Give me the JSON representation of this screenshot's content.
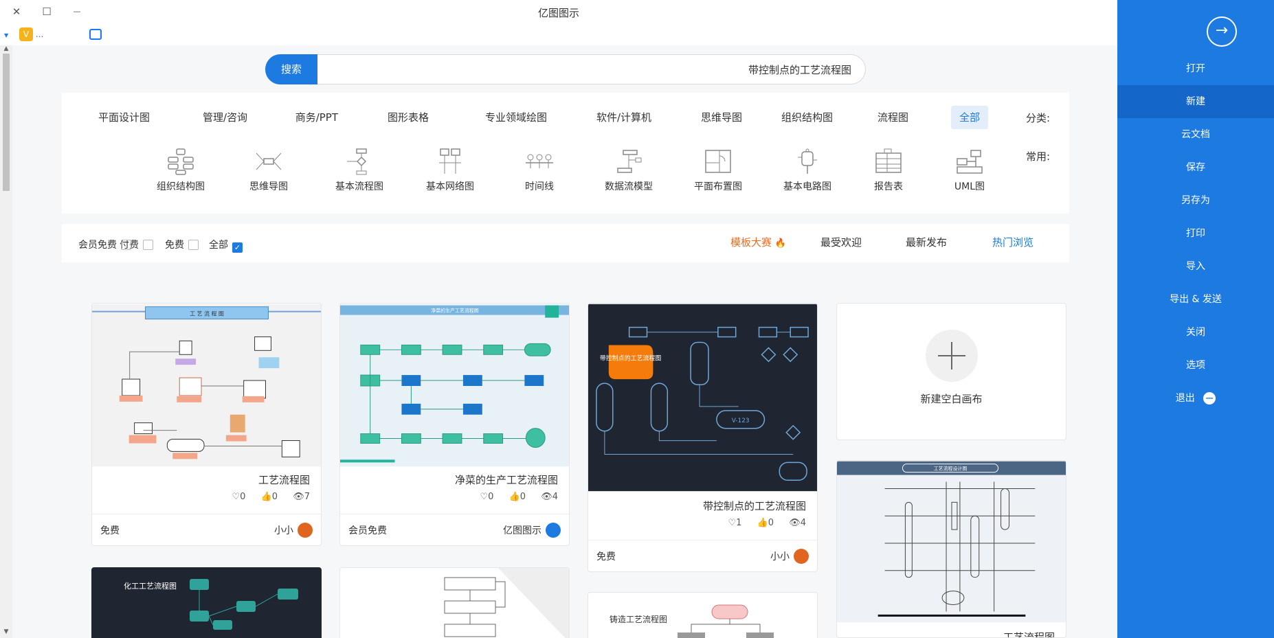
{
  "window": {
    "title": "亿图图示",
    "close": "✕",
    "maximize": "☐",
    "minimize": "—"
  },
  "toolbar": {
    "vip_dots": "...",
    "vip_symbol": "V"
  },
  "sidebar": {
    "back_icon": "→",
    "items": [
      "打开",
      "新建",
      "云文档",
      "保存",
      "另存为",
      "打印",
      "导入",
      "导出 & 发送",
      "关闭",
      "选项",
      "退出"
    ],
    "active": "新建",
    "exit_icon": "−"
  },
  "search": {
    "button": "搜索",
    "value": "带控制点的工艺流程图"
  },
  "categories": {
    "label": "分类:",
    "items": [
      "全部",
      "流程图",
      "组织结构图",
      "思维导图",
      "软件/计算机",
      "专业领域绘图",
      "图形表格",
      "商务/PPT",
      "管理/咨询",
      "平面设计图"
    ],
    "active": "全部"
  },
  "common": {
    "label": "常用:",
    "items": [
      "UML图",
      "报告表",
      "基本电路图",
      "平面布置图",
      "数据流模型",
      "时间线",
      "基本网络图",
      "基本流程图",
      "思维导图",
      "组织结构图"
    ]
  },
  "filters": {
    "tabs": [
      "热门浏览",
      "最新发布",
      "最受欢迎",
      "模板大赛"
    ],
    "active_tab": "热门浏览",
    "hot_icon": "🔥",
    "checks": [
      "全部",
      "免费",
      "付费",
      "会员免费"
    ],
    "checked": "全部",
    "check_mark": "✓"
  },
  "cards": [
    {
      "title": "工艺流程图",
      "views": "7",
      "likes": "0",
      "favs": "0",
      "author": "小小",
      "price": "免费"
    },
    {
      "title": "净菜的生产工艺流程图",
      "views": "4",
      "likes": "0",
      "favs": "0",
      "author": "亿图图示",
      "price": "会员免费"
    },
    {
      "title": "带控制点的工艺流程图",
      "views": "4",
      "likes": "0",
      "favs": "1",
      "author": "小小",
      "price": "免费"
    }
  ],
  "new_canvas": {
    "label": "新建空白画布"
  },
  "bottom_cards": {
    "c1_title": "化工工艺流程图",
    "c3_title": "铸造工艺流程图",
    "c4_title": "工艺流程图"
  },
  "thumb_texts": {
    "t1_header": "工 艺 流 程 图",
    "t2_header": "净菜的生产工艺流程图",
    "t3_bubble": "带控制点的工艺流程图",
    "t3_tank": "V-123",
    "t4_header": "工艺流程设计图"
  },
  "stat_icons": {
    "view": "👁",
    "like": "👍",
    "fav": "♡"
  },
  "colors": {
    "accent": "#1c7ae0",
    "hot": "#f26b1d",
    "dark_thumb": "#1f2631"
  }
}
